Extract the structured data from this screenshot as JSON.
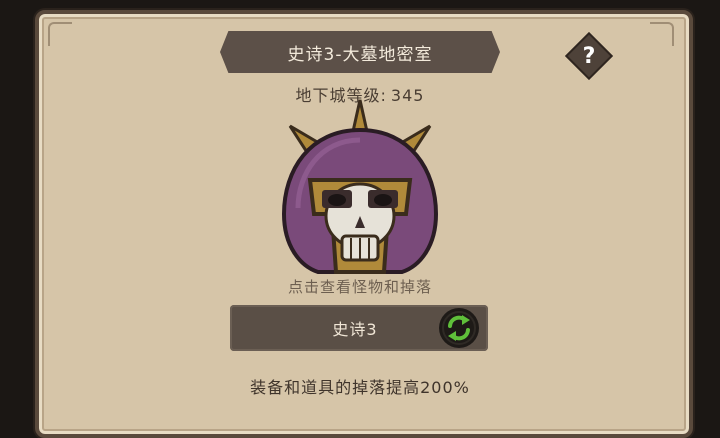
{
  "dialog": {
    "title": "史诗3-大墓地密室",
    "help_label": "?",
    "dungeon_level_label": "地下城等级:",
    "dungeon_level_value": "345",
    "boss_icon": "skull-helmet-icon",
    "hint": "点击查看怪物和掉落",
    "difficulty_label": "史诗3",
    "switch_icon": "swap-arrows-icon",
    "drop_bonus": "装备和道具的掉落提高200%"
  },
  "colors": {
    "panel_bg": "#d6c5a8",
    "banner_bg": "#5c5048",
    "button_bg": "#5a4f46",
    "switch_green": "#5fbf3a",
    "helmet_purple": "#7a4a7a",
    "helmet_gold": "#b08a3a"
  }
}
